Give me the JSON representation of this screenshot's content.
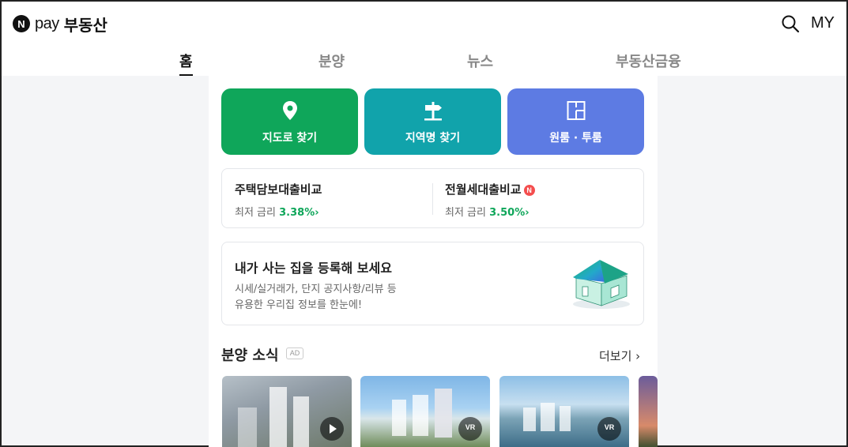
{
  "header": {
    "logo_mark": "N",
    "logo_pay": "pay",
    "logo_name": "부동산",
    "my_label": "MY"
  },
  "tabs": [
    {
      "label": "홈",
      "active": true
    },
    {
      "label": "분양",
      "active": false
    },
    {
      "label": "뉴스",
      "active": false
    },
    {
      "label": "부동산금융",
      "active": false
    }
  ],
  "quick_menu": [
    {
      "label": "지도로 찾기",
      "icon": "map-pin-icon",
      "color": "#0fa65a"
    },
    {
      "label": "지역명 찾기",
      "icon": "signpost-icon",
      "color": "#11a3ab"
    },
    {
      "label": "원룸 · 투룸",
      "icon": "floorplan-icon",
      "color": "#5d7be3"
    }
  ],
  "loans": [
    {
      "title": "주택담보대출비교",
      "sub_label": "최저 금리",
      "rate": "3.38%",
      "new_badge": false
    },
    {
      "title": "전월세대출비교",
      "sub_label": "최저 금리",
      "rate": "3.50%",
      "new_badge": true,
      "badge_text": "N"
    }
  ],
  "house_banner": {
    "title": "내가 사는 집을 등록해 보세요",
    "line1": "시세/실거래가, 단지 공지사항/리뷰 등",
    "line2": "유용한 우리집 정보를 한눈에!"
  },
  "presale": {
    "title": "분양 소식",
    "ad_label": "AD",
    "more_label": "더보기",
    "items": [
      {
        "media": "video",
        "icon": "play-icon"
      },
      {
        "media": "vr",
        "icon": "vr-icon",
        "vr_text": "VR"
      },
      {
        "media": "vr",
        "icon": "vr-icon",
        "vr_text": "VR"
      },
      {
        "media": "image"
      }
    ]
  },
  "colors": {
    "accent_green": "#0fa65a",
    "teal": "#11a3ab",
    "blue": "#5d7be3",
    "badge_red": "#f44e4e"
  }
}
